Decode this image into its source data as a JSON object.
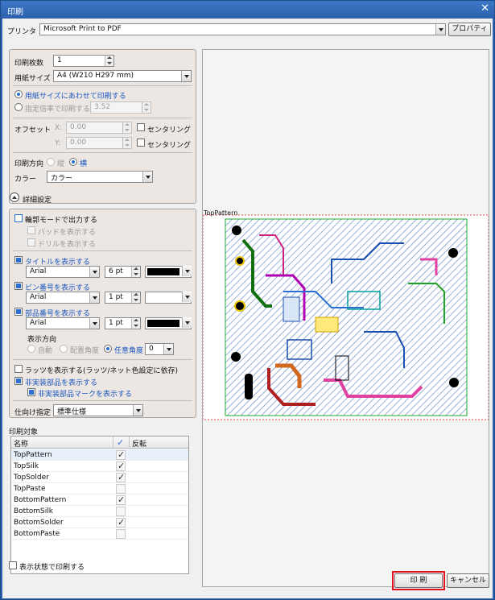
{
  "window": {
    "title": "印刷",
    "close_glyph": "✕"
  },
  "printer": {
    "label": "プリンタ",
    "value": "Microsoft Print to PDF",
    "properties_label": "プロパティ"
  },
  "basic": {
    "copies_label": "印刷枚数",
    "copies_value": "1",
    "paper_label": "用紙サイズ",
    "paper_value": "A4 (W210 H297 mm)",
    "fit_label": "用紙サイズにあわせて印刷する",
    "scale_label": "指定倍率で印刷する",
    "scale_value": "3.52",
    "offset_label": "オフセット",
    "x_label": "X:",
    "x_value": "0.00",
    "y_label": "Y:",
    "y_value": "0.00",
    "centering_label": "センタリング",
    "orientation_label": "印刷方向",
    "portrait_label": "縦",
    "landscape_label": "横",
    "color_label": "カラー",
    "color_value": "カラー"
  },
  "details": {
    "toggle_label": "詳細設定",
    "outline_label": "輪郭モードで出力する",
    "pad_label": "パッドを表示する",
    "drill_label": "ドリルを表示する",
    "title_label": "タイトルを表示する",
    "pin_label": "ピン番号を表示する",
    "part_label": "部品番号を表示する",
    "font": "Arial",
    "title_size": "6 pt",
    "pin_size": "1 pt",
    "part_size": "1 pt",
    "direction_label": "表示方向",
    "dir_auto": "自動",
    "dir_place": "配置角度",
    "dir_any": "任意角度",
    "angle_value": "0",
    "ratsnest_label": "ラッツを表示する(ラッツ/ネット色設定に依存)",
    "unmounted_label": "非実装部品を表示する",
    "unmounted_mark_label": "非実装部品マークを表示する",
    "spec_label": "仕向け指定",
    "spec_value": "標準仕様"
  },
  "targets": {
    "label": "印刷対象",
    "col_name": "名称",
    "col_check": "✓",
    "col_invert": "反転",
    "rows": [
      {
        "name": "TopPattern",
        "checked": true
      },
      {
        "name": "TopSilk",
        "checked": true
      },
      {
        "name": "TopSolder",
        "checked": true
      },
      {
        "name": "TopPaste",
        "checked": false
      },
      {
        "name": "BottomPattern",
        "checked": true
      },
      {
        "name": "BottomSilk",
        "checked": false
      },
      {
        "name": "BottomSolder",
        "checked": true
      },
      {
        "name": "BottomPaste",
        "checked": false
      }
    ]
  },
  "print_display_label": "表示状態で印刷する",
  "preview": {
    "caption": "TopPattern"
  },
  "buttons": {
    "print": "印 刷",
    "cancel": "キャンセル"
  },
  "colors": {
    "highlight": "#e0101c",
    "accent": "#2b6fd6"
  }
}
